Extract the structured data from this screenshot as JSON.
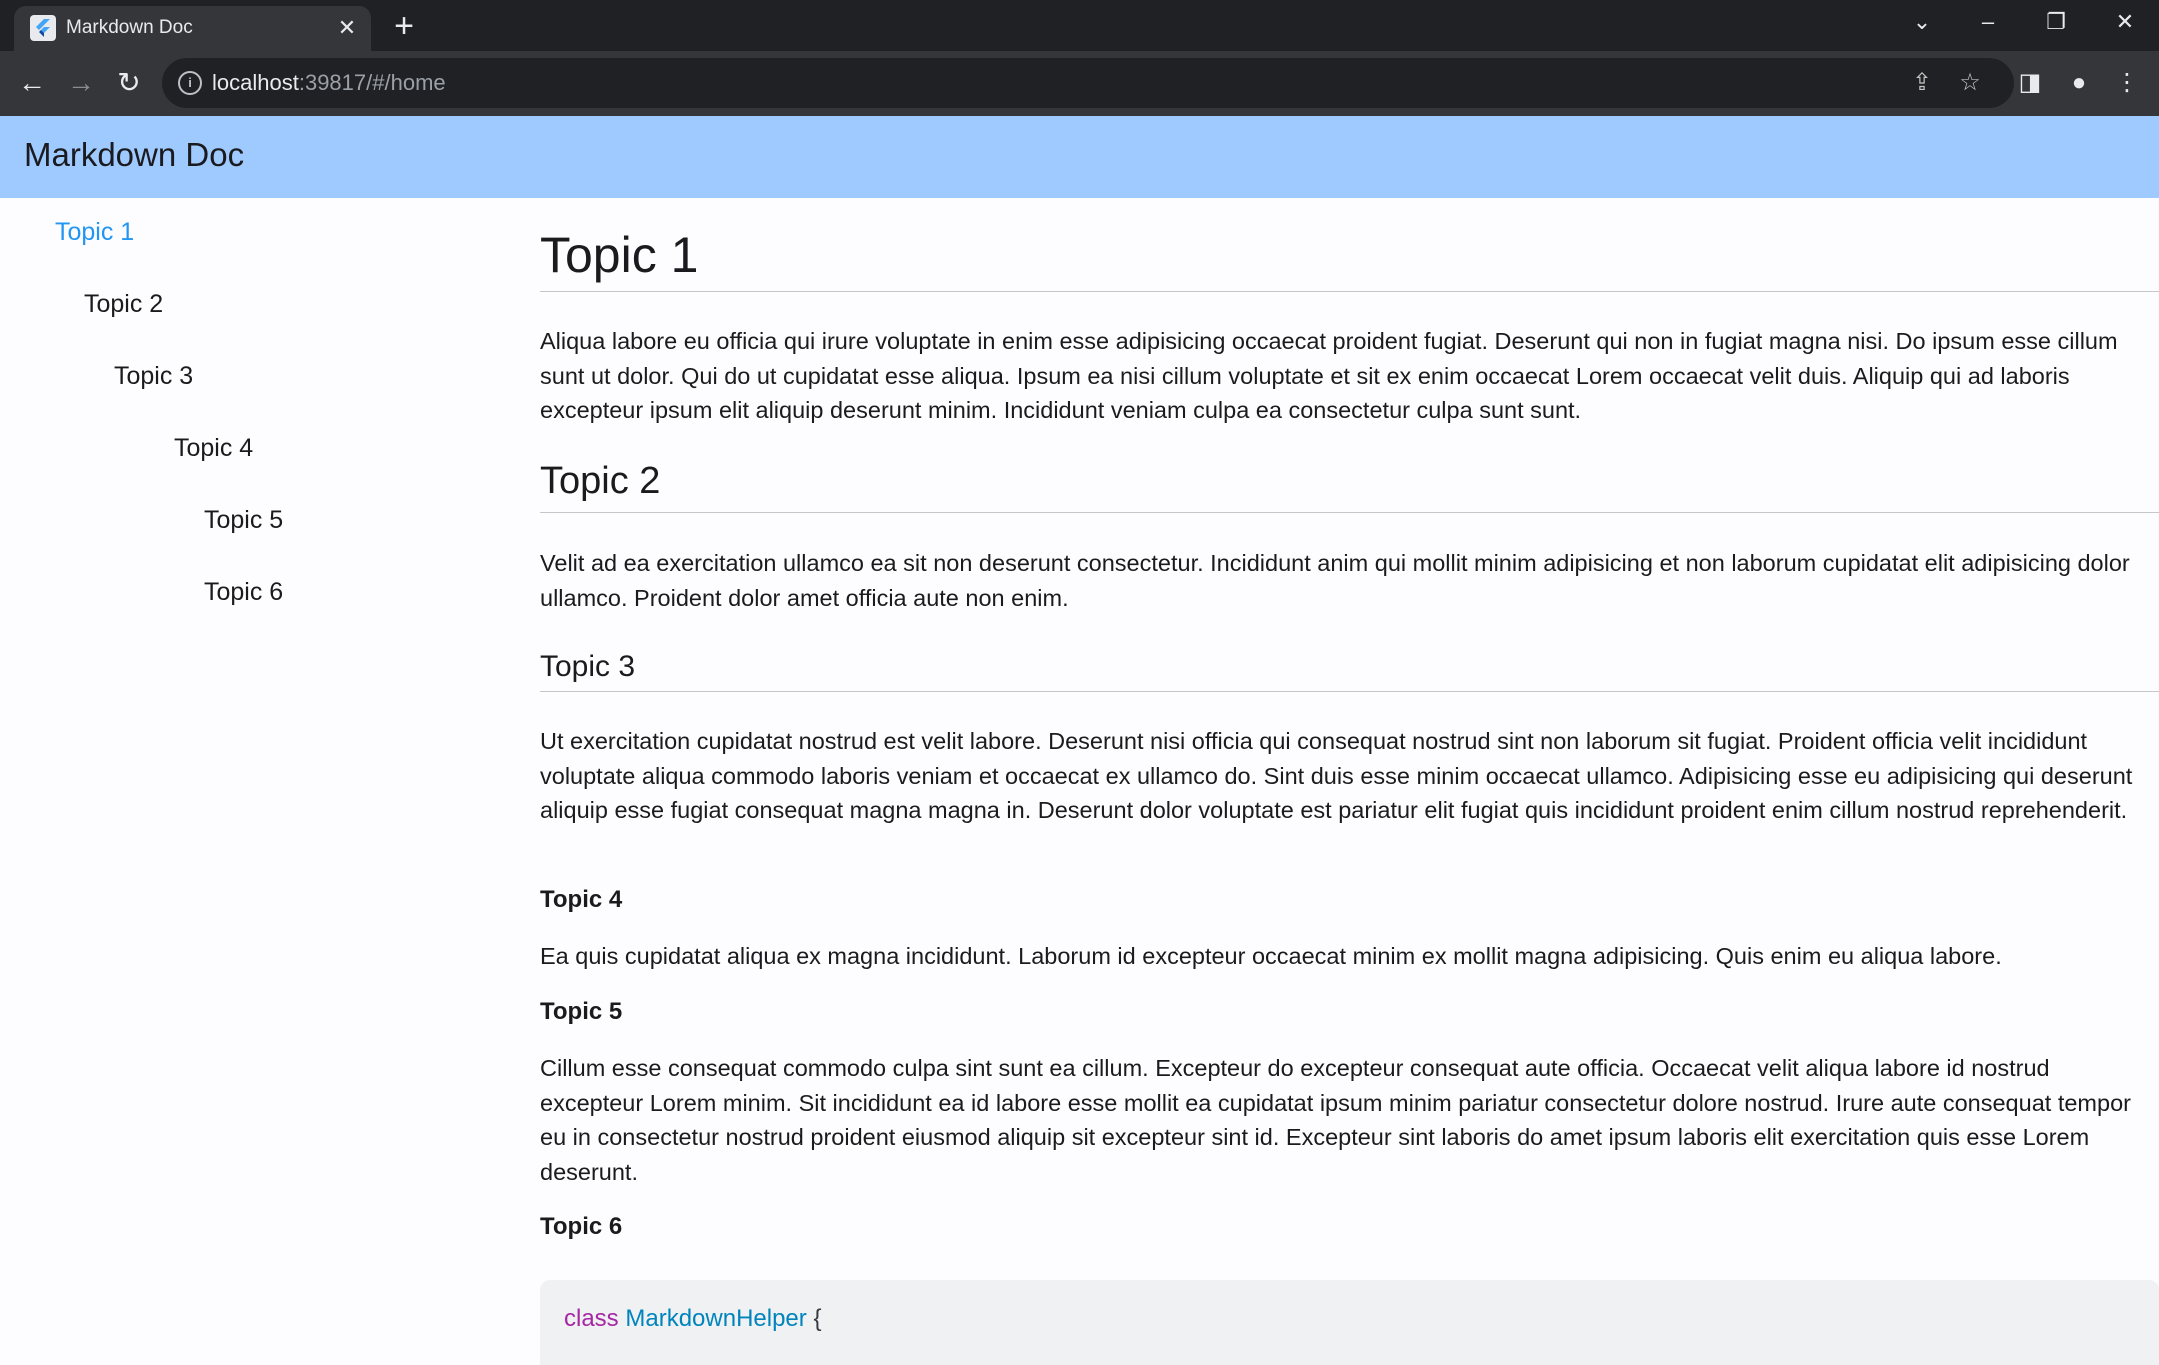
{
  "browser": {
    "tab_title": "Markdown Doc",
    "url_host": "localhost",
    "url_rest": ":39817/#/home",
    "colors": {
      "tabbar": "#202124",
      "toolbar": "#35363a"
    }
  },
  "app": {
    "title": "Markdown Doc",
    "appbar_color": "#9ecaff",
    "accent_color": "#2196f3"
  },
  "sidebar": {
    "items": [
      {
        "label": "Topic 1",
        "active": true
      },
      {
        "label": "Topic 2"
      },
      {
        "label": "Topic 3"
      },
      {
        "label": "Topic 4"
      },
      {
        "label": "Topic 5"
      },
      {
        "label": "Topic 6"
      }
    ]
  },
  "document": {
    "topic1": {
      "heading": "Topic 1",
      "body": "Aliqua labore eu officia qui irure voluptate in enim esse adipisicing occaecat proident fugiat. Deserunt qui non in fugiat magna nisi. Do ipsum esse cillum sunt ut dolor. Qui do ut cupidatat esse aliqua. Ipsum ea nisi cillum voluptate et sit ex enim occaecat Lorem occaecat velit duis. Aliquip qui ad laboris excepteur ipsum elit aliquip deserunt minim. Incididunt veniam culpa ea consectetur culpa sunt sunt."
    },
    "topic2": {
      "heading": "Topic 2",
      "body": "Velit ad ea exercitation ullamco ea sit non deserunt consectetur. Incididunt anim qui mollit minim adipisicing et non laborum cupidatat elit adipisicing dolor ullamco. Proident dolor amet officia aute non enim."
    },
    "topic3": {
      "heading": "Topic 3",
      "body": "Ut exercitation cupidatat nostrud est velit labore. Deserunt nisi officia qui consequat nostrud sint non laborum sit fugiat. Proident officia velit incididunt voluptate aliqua commodo laboris veniam et occaecat ex ullamco do. Sint duis esse minim occaecat ullamco. Adipisicing esse eu adipisicing qui deserunt aliquip esse fugiat consequat magna magna in. Deserunt dolor voluptate est pariatur elit fugiat quis incididunt proident enim cillum nostrud reprehenderit."
    },
    "topic4": {
      "heading": "Topic 4",
      "body": "Ea quis cupidatat aliqua ex magna incididunt. Laborum id excepteur occaecat minim ex mollit magna adipisicing. Quis enim eu aliqua labore."
    },
    "topic5": {
      "heading": "Topic 5",
      "body": "Cillum esse consequat commodo culpa sint sunt ea cillum. Excepteur do excepteur consequat aute officia. Occaecat velit aliqua labore id nostrud excepteur Lorem minim. Sit incididunt ea id labore esse mollit ea cupidatat ipsum minim pariatur consectetur dolore nostrud. Irure aute consequat tempor eu in consectetur nostrud proident eiusmod aliquip sit excepteur sint id. Excepteur sint laboris do amet ipsum laboris elit exercitation quis esse Lorem deserunt."
    },
    "topic6": {
      "heading": "Topic 6",
      "code": {
        "keyword": "class",
        "class_name": "MarkdownHelper",
        "brace": "{"
      }
    }
  }
}
